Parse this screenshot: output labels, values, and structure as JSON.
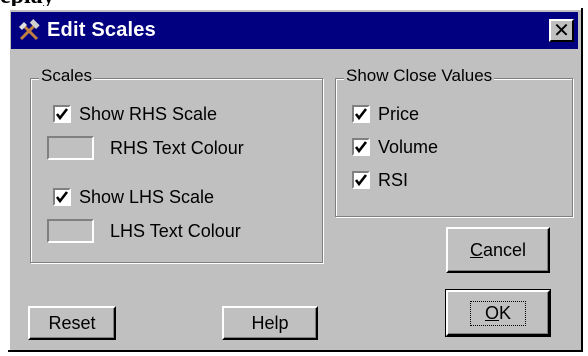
{
  "page_heading_fragment": "eplay",
  "dialog": {
    "title": "Edit Scales",
    "close_label": "✕"
  },
  "scales_group": {
    "label": "Scales",
    "show_rhs": {
      "label": "Show RHS Scale",
      "checked": true
    },
    "rhs_colour": {
      "label": "RHS Text Colour"
    },
    "show_lhs": {
      "label": "Show LHS Scale",
      "checked": true
    },
    "lhs_colour": {
      "label": "LHS Text Colour"
    }
  },
  "close_values_group": {
    "label": "Show Close Values",
    "items": [
      {
        "label": "Price",
        "checked": true
      },
      {
        "label": "Volume",
        "checked": true
      },
      {
        "label": "RSI",
        "checked": true
      }
    ]
  },
  "buttons": {
    "cancel_first": "C",
    "cancel_rest": "ancel",
    "ok_first": "O",
    "ok_rest": "K",
    "reset": "Reset",
    "help": "Help"
  },
  "colors": {
    "face": "#c0c0c0",
    "titlebar": "#000080",
    "title_text": "#ffffff"
  }
}
